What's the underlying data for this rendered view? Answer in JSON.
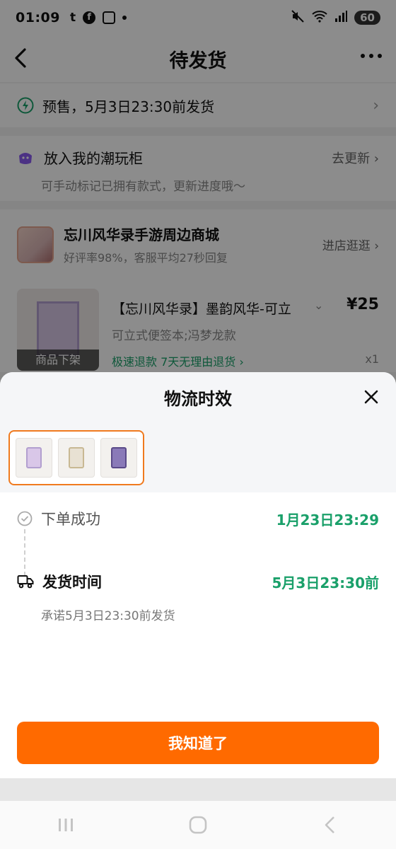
{
  "status_bar": {
    "time": "01:09",
    "battery": "60"
  },
  "nav": {
    "title": "待发货"
  },
  "presale": {
    "text": "预售，5月3日23:30前发货"
  },
  "cabinet": {
    "title": "放入我的潮玩柜",
    "link": "去更新",
    "subtitle": "可手动标记已拥有款式，更新进度哦～"
  },
  "shop": {
    "name": "忘川风华录手游周边商城",
    "rating": "好评率98%，客服平均27秒回复",
    "link": "进店逛逛"
  },
  "product": {
    "title": "【忘川风华录】墨韵风华-可立",
    "price": "¥25",
    "variant": "可立式便签本;冯梦龙款",
    "tags": "极速退款  7天无理由退货",
    "quantity": "x1",
    "status_badge": "商品下架"
  },
  "sheet": {
    "title": "物流时效",
    "thumb_count": 3,
    "timeline": [
      {
        "label": "下单成功",
        "time": "1月23日23:29",
        "icon": "check-circle-icon"
      },
      {
        "label": "发货时间",
        "time": "5月3日23:30前",
        "icon": "truck-icon"
      }
    ],
    "note": "承诺5月3日23:30前发货",
    "button": "我知道了"
  },
  "colors": {
    "accent": "#ff6a00",
    "green": "#1aa06a",
    "thumb_border": "#f07a1e"
  }
}
